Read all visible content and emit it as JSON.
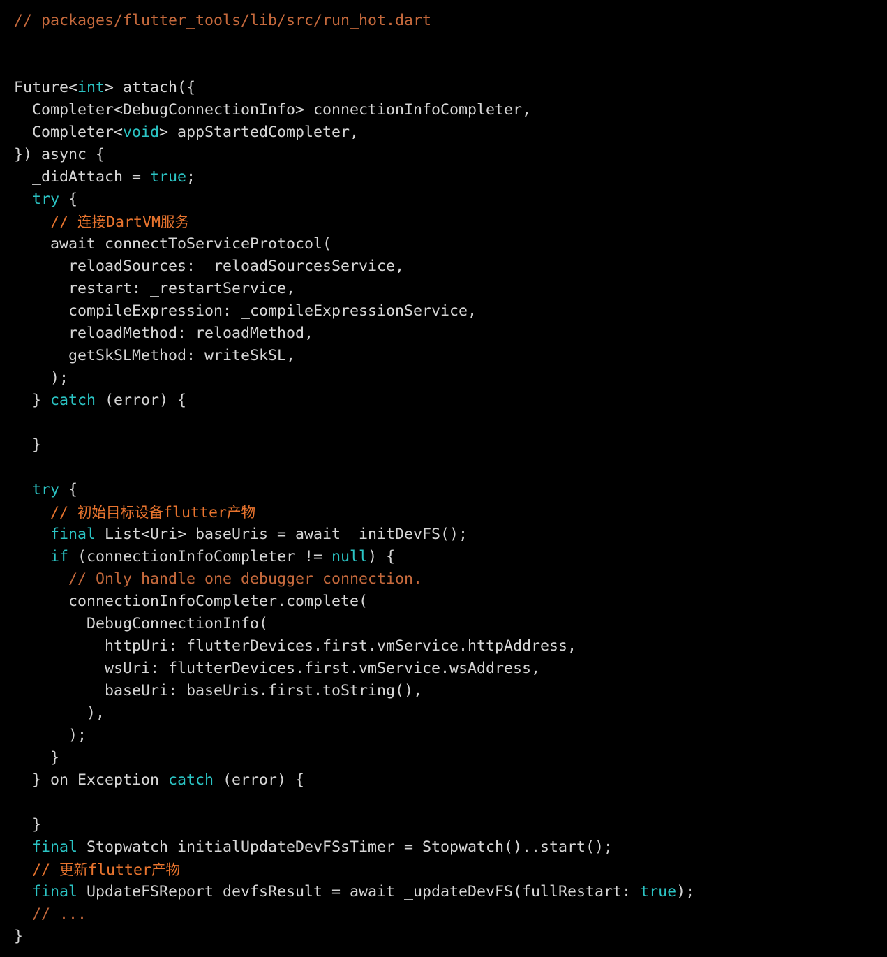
{
  "editor": {
    "background_color": "#000000",
    "default_text_color": "#d6d6d6",
    "keyword_color": "#2bc4c4",
    "comment_color": "#c5693c",
    "comment_cn_color": "#e8742e",
    "font_size_px": 21.6,
    "line_height_px": 32,
    "language": "dart",
    "file_path_comment": "// packages/flutter_tools/lib/src/run_hot.dart"
  },
  "lines": [
    {
      "id": 1,
      "segments": [
        {
          "t": "// packages/flutter_tools/lib/src/run_hot.dart",
          "c": "comment"
        }
      ]
    },
    {
      "id": 2,
      "segments": []
    },
    {
      "id": 3,
      "segments": []
    },
    {
      "id": 4,
      "segments": [
        {
          "t": "Future<",
          "c": "plain"
        },
        {
          "t": "int",
          "c": "keyword"
        },
        {
          "t": "> attach({",
          "c": "plain"
        }
      ]
    },
    {
      "id": 5,
      "segments": [
        {
          "t": "  Completer<DebugConnectionInfo> connectionInfoCompleter,",
          "c": "plain"
        }
      ]
    },
    {
      "id": 6,
      "segments": [
        {
          "t": "  Completer<",
          "c": "plain"
        },
        {
          "t": "void",
          "c": "keyword"
        },
        {
          "t": "> appStartedCompleter,",
          "c": "plain"
        }
      ]
    },
    {
      "id": 7,
      "segments": [
        {
          "t": "}) async {",
          "c": "plain"
        }
      ]
    },
    {
      "id": 8,
      "segments": [
        {
          "t": "  _didAttach = ",
          "c": "plain"
        },
        {
          "t": "true",
          "c": "keyword"
        },
        {
          "t": ";",
          "c": "plain"
        }
      ]
    },
    {
      "id": 9,
      "segments": [
        {
          "t": "  ",
          "c": "plain"
        },
        {
          "t": "try",
          "c": "keyword"
        },
        {
          "t": " {",
          "c": "plain"
        }
      ]
    },
    {
      "id": 10,
      "segments": [
        {
          "t": "    // ",
          "c": "comment_cn"
        },
        {
          "t": "连接",
          "c": "comment_cn_cjk"
        },
        {
          "t": "DartVM",
          "c": "comment_cn"
        },
        {
          "t": "服务",
          "c": "comment_cn_cjk"
        }
      ]
    },
    {
      "id": 11,
      "segments": [
        {
          "t": "    await connectToServiceProtocol(",
          "c": "plain"
        }
      ]
    },
    {
      "id": 12,
      "segments": [
        {
          "t": "      reloadSources: _reloadSourcesService,",
          "c": "plain"
        }
      ]
    },
    {
      "id": 13,
      "segments": [
        {
          "t": "      restart: _restartService,",
          "c": "plain"
        }
      ]
    },
    {
      "id": 14,
      "segments": [
        {
          "t": "      compileExpression: _compileExpressionService,",
          "c": "plain"
        }
      ]
    },
    {
      "id": 15,
      "segments": [
        {
          "t": "      reloadMethod: reloadMethod,",
          "c": "plain"
        }
      ]
    },
    {
      "id": 16,
      "segments": [
        {
          "t": "      getSkSLMethod: writeSkSL,",
          "c": "plain"
        }
      ]
    },
    {
      "id": 17,
      "segments": [
        {
          "t": "    );",
          "c": "plain"
        }
      ]
    },
    {
      "id": 18,
      "segments": [
        {
          "t": "  } ",
          "c": "plain"
        },
        {
          "t": "catch",
          "c": "keyword"
        },
        {
          "t": " (error) {",
          "c": "plain"
        }
      ]
    },
    {
      "id": 19,
      "segments": []
    },
    {
      "id": 20,
      "segments": [
        {
          "t": "  }",
          "c": "plain"
        }
      ]
    },
    {
      "id": 21,
      "segments": []
    },
    {
      "id": 22,
      "segments": [
        {
          "t": "  ",
          "c": "plain"
        },
        {
          "t": "try",
          "c": "keyword"
        },
        {
          "t": " {",
          "c": "plain"
        }
      ]
    },
    {
      "id": 23,
      "segments": [
        {
          "t": "    // ",
          "c": "comment_cn"
        },
        {
          "t": "初始目标设备",
          "c": "comment_cn_cjk"
        },
        {
          "t": "flutter",
          "c": "comment_cn"
        },
        {
          "t": "产物",
          "c": "comment_cn_cjk"
        }
      ]
    },
    {
      "id": 24,
      "segments": [
        {
          "t": "    ",
          "c": "plain"
        },
        {
          "t": "final",
          "c": "keyword"
        },
        {
          "t": " List<Uri> baseUris = await _initDevFS();",
          "c": "plain"
        }
      ]
    },
    {
      "id": 25,
      "segments": [
        {
          "t": "    ",
          "c": "plain"
        },
        {
          "t": "if",
          "c": "keyword"
        },
        {
          "t": " (connectionInfoCompleter != ",
          "c": "plain"
        },
        {
          "t": "null",
          "c": "keyword"
        },
        {
          "t": ") {",
          "c": "plain"
        }
      ]
    },
    {
      "id": 26,
      "segments": [
        {
          "t": "      // Only handle one debugger connection.",
          "c": "comment"
        }
      ]
    },
    {
      "id": 27,
      "segments": [
        {
          "t": "      connectionInfoCompleter.complete(",
          "c": "plain"
        }
      ]
    },
    {
      "id": 28,
      "segments": [
        {
          "t": "        DebugConnectionInfo(",
          "c": "plain"
        }
      ]
    },
    {
      "id": 29,
      "segments": [
        {
          "t": "          httpUri: flutterDevices.first.vmService.httpAddress,",
          "c": "plain"
        }
      ]
    },
    {
      "id": 30,
      "segments": [
        {
          "t": "          wsUri: flutterDevices.first.vmService.wsAddress,",
          "c": "plain"
        }
      ]
    },
    {
      "id": 31,
      "segments": [
        {
          "t": "          baseUri: baseUris.first.toString(),",
          "c": "plain"
        }
      ]
    },
    {
      "id": 32,
      "segments": [
        {
          "t": "        ),",
          "c": "plain"
        }
      ]
    },
    {
      "id": 33,
      "segments": [
        {
          "t": "      );",
          "c": "plain"
        }
      ]
    },
    {
      "id": 34,
      "segments": [
        {
          "t": "    }",
          "c": "plain"
        }
      ]
    },
    {
      "id": 35,
      "segments": [
        {
          "t": "  } on Exception ",
          "c": "plain"
        },
        {
          "t": "catch",
          "c": "keyword"
        },
        {
          "t": " (error) {",
          "c": "plain"
        }
      ]
    },
    {
      "id": 36,
      "segments": []
    },
    {
      "id": 37,
      "segments": [
        {
          "t": "  }",
          "c": "plain"
        }
      ]
    },
    {
      "id": 38,
      "segments": [
        {
          "t": "  ",
          "c": "plain"
        },
        {
          "t": "final",
          "c": "keyword"
        },
        {
          "t": " Stopwatch initialUpdateDevFSsTimer = Stopwatch()..start();",
          "c": "plain"
        }
      ]
    },
    {
      "id": 39,
      "segments": [
        {
          "t": "  // ",
          "c": "comment_cn"
        },
        {
          "t": "更新",
          "c": "comment_cn_cjk"
        },
        {
          "t": "flutter",
          "c": "comment_cn"
        },
        {
          "t": "产物",
          "c": "comment_cn_cjk"
        }
      ]
    },
    {
      "id": 40,
      "segments": [
        {
          "t": "  ",
          "c": "plain"
        },
        {
          "t": "final",
          "c": "keyword"
        },
        {
          "t": " UpdateFSReport devfsResult = await _updateDevFS(fullRestart: ",
          "c": "plain"
        },
        {
          "t": "true",
          "c": "keyword"
        },
        {
          "t": ");",
          "c": "plain"
        }
      ]
    },
    {
      "id": 41,
      "segments": [
        {
          "t": "  // ...",
          "c": "comment"
        }
      ]
    },
    {
      "id": 42,
      "segments": [
        {
          "t": "}",
          "c": "plain"
        }
      ]
    }
  ]
}
